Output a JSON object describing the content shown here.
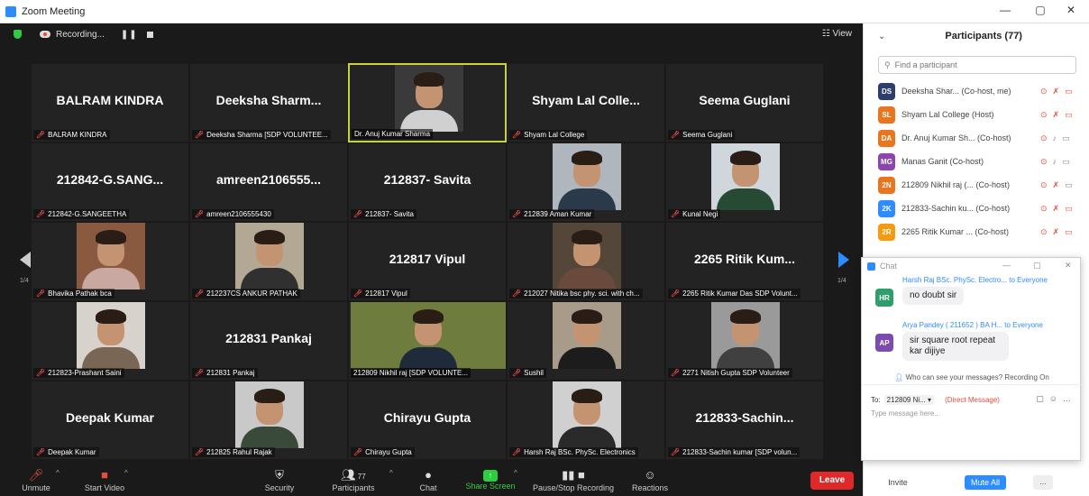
{
  "window": {
    "title": "Zoom Meeting",
    "minimize": "—",
    "restore": "▢",
    "close": "✕"
  },
  "topbar": {
    "recording": "Recording...",
    "pause": "❚❚",
    "view": "☷ View"
  },
  "nav": {
    "page_left": "1/4",
    "page_right": "1/4"
  },
  "tiles": [
    {
      "big": "BALRAM KINDRA",
      "label": "BALRAM KINDRA",
      "muted": true
    },
    {
      "big": "Deeksha Sharm...",
      "label": "Deeksha Sharma [SDP VOLUNTEE...",
      "muted": true
    },
    {
      "label": "Dr. Anuj Kumar Sharma",
      "muted": false,
      "video": true,
      "active": true,
      "bg": "#3a3a3a",
      "shirt": "#d0d0d0"
    },
    {
      "big": "Shyam Lal Colle...",
      "label": "Shyam Lal College",
      "muted": true
    },
    {
      "big": "Seema Guglani",
      "label": "Seema Guglani",
      "muted": true
    },
    {
      "big": "212842-G.SANG...",
      "label": "212842-G.SANGEETHA",
      "muted": true
    },
    {
      "big": "amreen2106555...",
      "label": "amreen2106555430",
      "muted": true
    },
    {
      "big": "212837- Savita",
      "label": "212837- Savita",
      "muted": true
    },
    {
      "label": "212839 Aman Kumar",
      "muted": true,
      "video": true,
      "bg": "#b0b6bd",
      "shirt": "#2b3a4a"
    },
    {
      "label": "Kunal Negi",
      "muted": true,
      "video": true,
      "bg": "#cfd6dc",
      "shirt": "#264a33"
    },
    {
      "label": "Bhavika Pathak bca",
      "muted": true,
      "video": true,
      "bg": "#8a5a40",
      "shirt": "#c8a8a0"
    },
    {
      "label": "212237CS ANKUR PATHAK",
      "muted": true,
      "video": true,
      "bg": "#b3a894",
      "shirt": "#303030"
    },
    {
      "big": "212817 Vipul",
      "label": "212817 Vipul",
      "muted": true
    },
    {
      "label": "212027 Nitika bsc phy. sci. with ch...",
      "muted": true,
      "video": true,
      "bg": "#55463a",
      "shirt": "#6a4a3c"
    },
    {
      "big": "2265 Ritik Kum...",
      "label": "2265 Ritik Kumar Das SDP Volunt...",
      "muted": true
    },
    {
      "label": "212823-Prashant Saini",
      "muted": true,
      "video": true,
      "bg": "#d7d2cc",
      "shirt": "#7a6654"
    },
    {
      "big": "212831 Pankaj",
      "label": "212831 Pankaj",
      "muted": true
    },
    {
      "label": "212809 Nikhil raj [SDP VOLUNTE...",
      "muted": false,
      "video": true,
      "wide": true,
      "bg": "#6e7c3e",
      "shirt": "#1f2a3a"
    },
    {
      "label": "Sushil",
      "muted": true,
      "video": true,
      "bg": "#a89b8a",
      "shirt": "#1c1c1c"
    },
    {
      "label": "2271 Nitish Gupta SDP Volunteer",
      "muted": true,
      "video": true,
      "bg": "#9a9a9a",
      "shirt": "#404040"
    },
    {
      "big": "Deepak Kumar",
      "label": "Deepak Kumar",
      "muted": true
    },
    {
      "label": "212825 Rahul Rajak",
      "muted": true,
      "video": true,
      "bg": "#c9c9c9",
      "shirt": "#3a4a3a"
    },
    {
      "big": "Chirayu Gupta",
      "label": "Chirayu Gupta",
      "muted": true
    },
    {
      "label": "Harsh Raj BSc. PhySc. Electronics",
      "muted": true,
      "video": true,
      "bg": "#d0d0d0",
      "shirt": "#2a2a2a"
    },
    {
      "big": "212833-Sachin...",
      "label": "212833-Sachin kumar [SDP volun...",
      "muted": true
    }
  ],
  "toolbar": {
    "unmute": "Unmute",
    "start_video": "Start Video",
    "security": "Security",
    "participants": "Participants",
    "participants_count": "77",
    "chat": "Chat",
    "share": "Share Screen",
    "record": "Pause/Stop Recording",
    "reactions": "Reactions",
    "leave": "Leave"
  },
  "participants": {
    "title": "Participants (77)",
    "search_placeholder": "Find a participant",
    "list": [
      {
        "initials": "DS",
        "color": "#2c3e6b",
        "name": "Deeksha Shar...  (Co-host, me)",
        "mic_muted": true,
        "video_off": true
      },
      {
        "initials": "SL",
        "color": "#e8761e",
        "name": "Shyam Lal College (Host)",
        "mic_muted": true,
        "video_off": true
      },
      {
        "initials": "DA",
        "color": "#e8761e",
        "name": "Dr. Anuj Kumar Sh...  (Co-host)",
        "mic_muted": false,
        "video_off": false
      },
      {
        "initials": "MG",
        "color": "#8e44ad",
        "name": "Manas Ganit (Co-host)",
        "mic_muted": false,
        "video_off": false
      },
      {
        "initials": "2N",
        "color": "#e8761e",
        "name": "212809 Nikhil raj (...  (Co-host)",
        "mic_muted": true,
        "video_off": false
      },
      {
        "initials": "2K",
        "color": "#2d8cff",
        "name": "212833-Sachin ku...  (Co-host)",
        "mic_muted": true,
        "video_off": true
      },
      {
        "initials": "2R",
        "color": "#f39c12",
        "name": "2265 Ritik Kumar ...  (Co-host)",
        "mic_muted": true,
        "video_off": true
      }
    ],
    "invite": "Invite",
    "mute_all": "Mute All",
    "more": "..."
  },
  "chat": {
    "title": "Chat",
    "messages": [
      {
        "from": "Harsh Raj BSc. PhySc. Electro...",
        "to": "to Everyone",
        "initials": "HR",
        "color": "#2e9e6b",
        "text": "no doubt sir"
      },
      {
        "from": "Arya Pandey ( 211652 ) BA H...",
        "to": "to Everyone",
        "initials": "AP",
        "color": "#7d4ab0",
        "text": "sir square root repeat kar dijiye"
      }
    ],
    "who_sees": "Who can see your messages? Recording On",
    "to_label": "To:",
    "to_value": "212809 Ni...",
    "direct": "(Direct Message)",
    "input_placeholder": "Type message here..."
  }
}
